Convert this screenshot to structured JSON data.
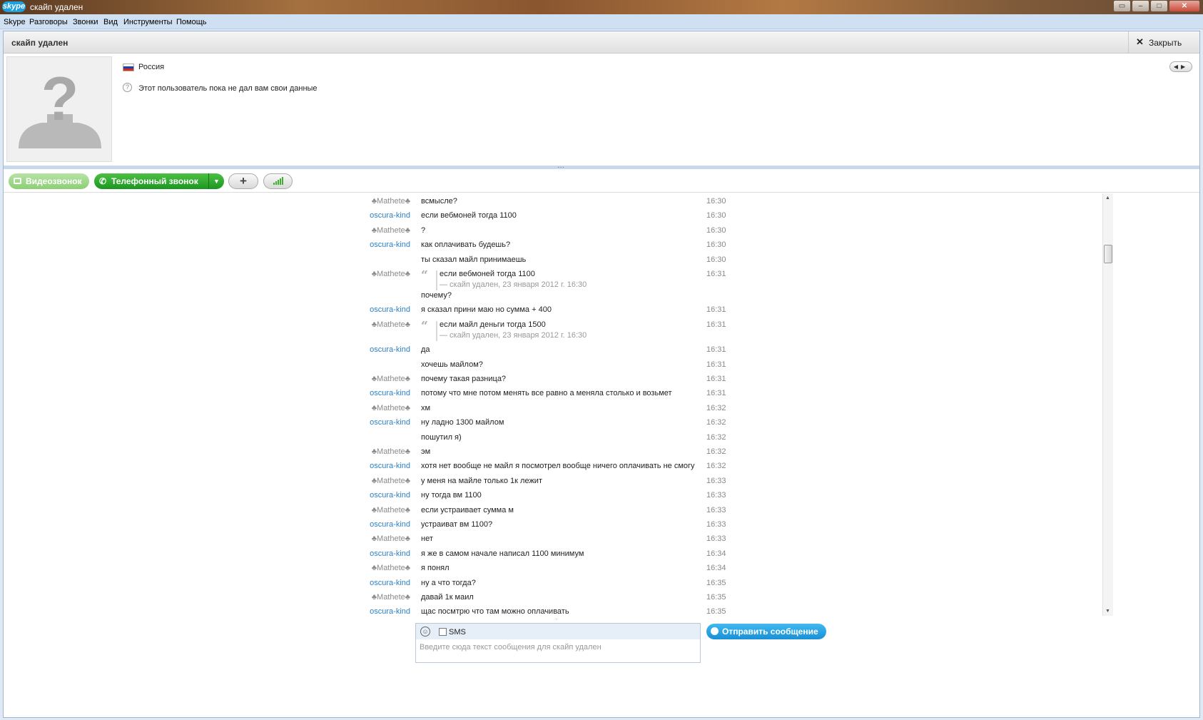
{
  "titlebar": {
    "logo": "skype",
    "title": "скайп удален",
    "buttons": [
      "▭",
      "–",
      "□",
      "✕"
    ]
  },
  "menu": [
    "Skype",
    "Разговоры",
    "Звонки",
    "Вид",
    "Инструменты",
    "Помощь"
  ],
  "header": {
    "contact_name": "скайп удален",
    "close_label": "Закрыть"
  },
  "profile": {
    "country": "Россия",
    "info": "Этот пользователь пока не дал вам свои данные",
    "flag_colors": [
      "#ffffff",
      "#1c3fae",
      "#d52b1e"
    ]
  },
  "buttons": {
    "video_call": "Видеозвонок",
    "phone_call": "Телефонный звонок",
    "add": "+"
  },
  "messages": [
    {
      "sender": "♣Mathete♣",
      "kind": "m",
      "text": "всмысле?",
      "time": "16:30"
    },
    {
      "sender": "oscura-kind",
      "kind": "o",
      "text": "если вебмоней тогда 1100",
      "time": "16:30"
    },
    {
      "sender": "♣Mathete♣",
      "kind": "m",
      "text": "?",
      "time": "16:30"
    },
    {
      "sender": "oscura-kind",
      "kind": "o",
      "text": "как оплачивать будешь?",
      "time": "16:30"
    },
    {
      "sender": "",
      "kind": "o",
      "text": "ты сказал майл принимаешь",
      "time": "16:30"
    },
    {
      "sender": "♣Mathete♣",
      "kind": "m",
      "quote": "если вебмоней тогда 1100",
      "quote_meta": "— скайп удален, 23 января 2012 г. 16:30",
      "text": "почему?",
      "time": "16:31"
    },
    {
      "sender": "oscura-kind",
      "kind": "o",
      "text": "я сказал прини маю но сумма + 400",
      "time": "16:31"
    },
    {
      "sender": "♣Mathete♣",
      "kind": "m",
      "quote": "если майл деньги тогда 1500",
      "quote_meta": "— скайп удален, 23 января 2012 г. 16:30",
      "text": "",
      "time": "16:31"
    },
    {
      "sender": "oscura-kind",
      "kind": "o",
      "text": "да",
      "time": "16:31"
    },
    {
      "sender": "",
      "kind": "o",
      "text": "хочешь майлом?",
      "time": "16:31"
    },
    {
      "sender": "♣Mathete♣",
      "kind": "m",
      "text": "почему такая разница?",
      "time": "16:31"
    },
    {
      "sender": "oscura-kind",
      "kind": "o",
      "text": "потому что мне потом менять все равно а меняла столько и возьмет",
      "time": "16:31"
    },
    {
      "sender": "♣Mathete♣",
      "kind": "m",
      "text": "хм",
      "time": "16:32"
    },
    {
      "sender": "oscura-kind",
      "kind": "o",
      "text": "ну ладно 1300 майлом",
      "time": "16:32"
    },
    {
      "sender": "",
      "kind": "o",
      "text": "пошутил я)",
      "time": "16:32"
    },
    {
      "sender": "♣Mathete♣",
      "kind": "m",
      "text": "эм",
      "time": "16:32"
    },
    {
      "sender": "oscura-kind",
      "kind": "o",
      "text": "хотя нет вообще не майл я посмотрел вообще ничего оплачивать не смогу",
      "time": "16:32"
    },
    {
      "sender": "♣Mathete♣",
      "kind": "m",
      "text": "у меня на майле только 1к лежит",
      "time": "16:33"
    },
    {
      "sender": "oscura-kind",
      "kind": "o",
      "text": "ну тогда вм 1100",
      "time": "16:33"
    },
    {
      "sender": "♣Mathete♣",
      "kind": "m",
      "text": "если устраивает сумма м",
      "time": "16:33"
    },
    {
      "sender": "oscura-kind",
      "kind": "o",
      "text": "устраиват вм 1100?",
      "time": "16:33"
    },
    {
      "sender": "♣Mathete♣",
      "kind": "m",
      "text": "нет",
      "time": "16:33"
    },
    {
      "sender": "oscura-kind",
      "kind": "o",
      "text": "я же в самом начале написал 1100 минимум",
      "time": "16:34"
    },
    {
      "sender": "♣Mathete♣",
      "kind": "m",
      "text": "я понял",
      "time": "16:34"
    },
    {
      "sender": "oscura-kind",
      "kind": "o",
      "text": "ну а что тогда?",
      "time": "16:35"
    },
    {
      "sender": "♣Mathete♣",
      "kind": "m",
      "text": "давай 1к маил",
      "time": "16:35"
    },
    {
      "sender": "oscura-kind",
      "kind": "o",
      "text": "щас посмтрю что там можно оплачивать",
      "time": "16:35"
    }
  ],
  "input": {
    "sms_label": "SMS",
    "placeholder": "Введите сюда текст сообщения для скайп удален",
    "send_label": "Отправить сообщение"
  }
}
